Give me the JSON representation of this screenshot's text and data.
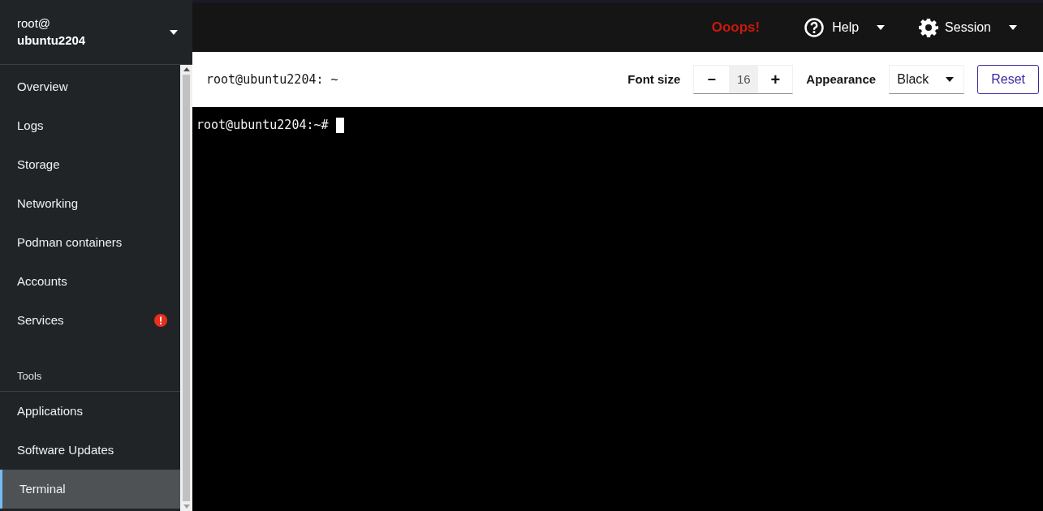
{
  "host": {
    "user": "root@",
    "name": "ubuntu2204"
  },
  "topbar": {
    "alert": "Ooops!",
    "help": "Help",
    "session": "Session"
  },
  "nav": [
    {
      "items": [
        {
          "label": "Overview",
          "selected": false,
          "alert": false
        },
        {
          "label": "Logs",
          "selected": false,
          "alert": false
        },
        {
          "label": "Storage",
          "selected": false,
          "alert": false
        },
        {
          "label": "Networking",
          "selected": false,
          "alert": false
        },
        {
          "label": "Podman containers",
          "selected": false,
          "alert": false
        },
        {
          "label": "Accounts",
          "selected": false,
          "alert": false
        },
        {
          "label": "Services",
          "selected": false,
          "alert": true
        }
      ]
    },
    {
      "label": "Tools",
      "items": [
        {
          "label": "Applications",
          "selected": false,
          "alert": false
        },
        {
          "label": "Software Updates",
          "selected": false,
          "alert": false
        },
        {
          "label": "Terminal",
          "selected": true,
          "alert": false
        }
      ]
    }
  ],
  "toolbar": {
    "title": "root@ubuntu2204: ~",
    "font_size_label": "Font size",
    "minus": "−",
    "font_size": "16",
    "plus": "+",
    "appearance_label": "Appearance",
    "appearance": "Black",
    "reset": "Reset"
  },
  "terminal": {
    "prompt": "root@ubuntu2204:~#"
  }
}
